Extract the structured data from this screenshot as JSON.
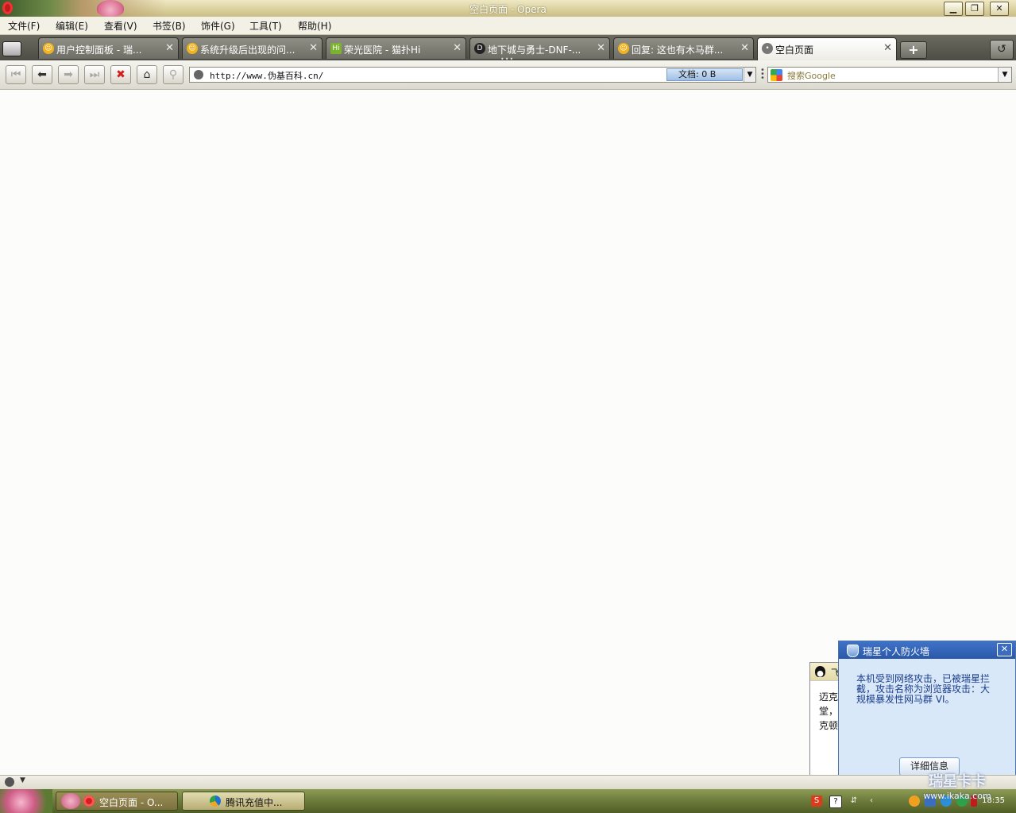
{
  "window": {
    "title": "空白页面 - Opera"
  },
  "menu": [
    "文件(F)",
    "编辑(E)",
    "查看(V)",
    "书签(B)",
    "饰件(G)",
    "工具(T)",
    "帮助(H)"
  ],
  "tabs": [
    {
      "label": "用户控制面板 - 瑞...",
      "icon": "smiley-icon",
      "active": false
    },
    {
      "label": "系统升级后出现的问...",
      "icon": "smiley-icon",
      "active": false
    },
    {
      "label": "荣光医院 - 猫扑Hi",
      "icon": "hi-icon",
      "active": false
    },
    {
      "label": "地下城与勇士-DNF-...",
      "icon": "dnf-icon",
      "active": false
    },
    {
      "label": "回复: 这也有木马群...",
      "icon": "smiley-icon",
      "active": false
    },
    {
      "label": "空白页面",
      "icon": "blank-page-icon",
      "active": true
    }
  ],
  "address": {
    "url": "http://www.伪基百科.cn/",
    "doc_size": "文档: 0 B"
  },
  "search": {
    "placeholder": "搜索Google"
  },
  "taskbar": {
    "items": [
      {
        "label": "空白页面 - O...",
        "active": true
      },
      {
        "label": "腾讯充值中...",
        "active": false
      }
    ],
    "clock": "18:35"
  },
  "qq_popup": {
    "title_fragment": "飞",
    "lines": [
      "迈克",
      "堂，",
      "克顿"
    ]
  },
  "firewall": {
    "title": "瑞星个人防火墙",
    "message": "本机受到网络攻击，已被瑞星拦截，攻击名称为浏览器攻击：大规模暴发性网马群 VI。",
    "button": "详细信息"
  },
  "watermark": {
    "main": "瑞星卡卡",
    "sub": "www.ikaka.com"
  },
  "colors": {
    "tab_bar": "#5a5a52",
    "taskbar": "#6c7a3b",
    "firewall_header": "#2a58a8",
    "accent_red": "#d21f1f"
  }
}
